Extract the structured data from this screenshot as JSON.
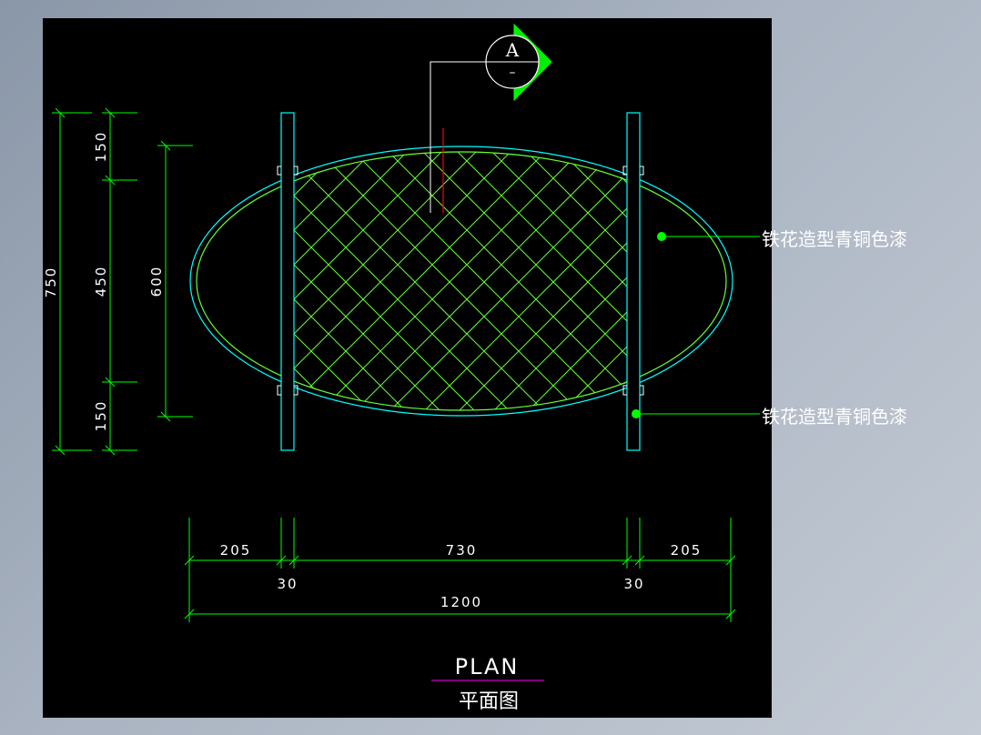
{
  "colors": {
    "background": "#000000",
    "dimension_line": "#00ff00",
    "outline": "#00ffff",
    "hatch": "#66ff33",
    "text": "#ffffff",
    "section_line": "#ff0000",
    "title_underline": "#cc00cc"
  },
  "section_marker": {
    "letter": "A",
    "sub": "–"
  },
  "dimensions": {
    "left_outer_total": "750",
    "left_top": "150",
    "left_middle": "450",
    "left_bottom": "150",
    "left_inner_height": "600",
    "bottom_left": "205",
    "bottom_center": "730",
    "bottom_right": "205",
    "bottom_post_left": "30",
    "bottom_post_right": "30",
    "bottom_total": "1200"
  },
  "annotations": {
    "top_callout": "铁花造型青铜色漆",
    "bottom_callout": "铁花造型青铜色漆"
  },
  "title": {
    "english": "PLAN",
    "chinese": "平面图"
  }
}
